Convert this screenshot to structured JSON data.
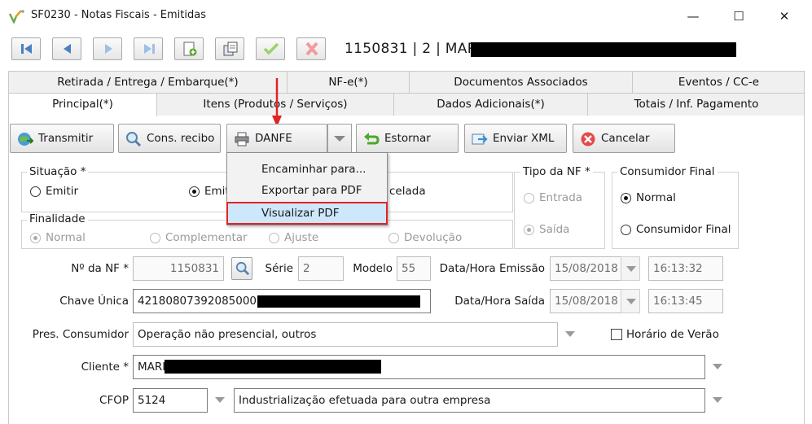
{
  "window": {
    "title": "SF0230 - Notas Fiscais - Emitidas",
    "controls": [
      "—",
      "☐",
      "✕"
    ]
  },
  "toolbar": {
    "record": "1150831 | 2 | MAR",
    "buttons": [
      "first-record-icon",
      "previous-record-icon",
      "next-record-icon",
      "last-record-icon",
      "new-document-icon",
      "copy-document-icon",
      "confirm-check-icon",
      "cancel-x-icon"
    ]
  },
  "tabs": {
    "row1": [
      "Retirada / Entrega / Embarque(*)",
      "NF-e(*)",
      "Documentos Associados",
      "Eventos / CC-e"
    ],
    "row2": [
      "Principal(*)",
      "Itens (Produtos / Serviços)",
      "Dados Adicionais(*)",
      "Totais / Inf. Pagamento"
    ],
    "active": "Principal(*)"
  },
  "actions": {
    "transmitir": "Transmitir",
    "cons_recibo": "Cons. recibo",
    "danfe": "DANFE",
    "estornar": "Estornar",
    "enviar_xml": "Enviar XML",
    "cancelar": "Cancelar"
  },
  "danfe_menu": {
    "items": [
      "Encaminhar para...",
      "Exportar para PDF",
      "Visualizar PDF"
    ],
    "highlighted": "Visualizar PDF"
  },
  "situacao": {
    "title": "Situação *",
    "emitir": "Emitir",
    "emitida_partial": "Emit",
    "cancelada_partial": "celada",
    "selected": "Emitida"
  },
  "finalidade": {
    "title": "Finalidade",
    "options": [
      "Normal",
      "Complementar",
      "Ajuste",
      "Devolução"
    ],
    "selected": "Normal"
  },
  "tipo_nf": {
    "title": "Tipo da NF *",
    "entrada": "Entrada",
    "saida": "Saída",
    "selected": "Saída"
  },
  "consumidor_final": {
    "title": "Consumidor Final",
    "normal": "Normal",
    "consumidor": "Consumidor Final",
    "selected": "Normal"
  },
  "form": {
    "nf_label": "Nº da NF *",
    "nf_value": "1150831",
    "serie_label": "Série",
    "serie_value": "2",
    "modelo_label": "Modelo",
    "modelo_value": "55",
    "emissao_label": "Data/Hora Emissão",
    "emissao_date": "15/08/2018",
    "emissao_time": "16:13:32",
    "chave_label": "Chave Única",
    "chave_value": "4218080739208500014",
    "saida_label": "Data/Hora Saída",
    "saida_date": "15/08/2018",
    "saida_time": "16:13:45",
    "pres_label": "Pres. Consumidor",
    "pres_value": "Operação não presencial, outros",
    "verao_label": "Horário de Verão",
    "cliente_label": "Cliente *",
    "cliente_value": "MARI",
    "cfop_label": "CFOP",
    "cfop_value": "5124",
    "cfop_desc": "Industrialização efetuada para outra empresa"
  },
  "colors": {
    "highlight_border": "#e02424",
    "arrow": "#e02424",
    "menu_highlight": "#cde8fb"
  }
}
